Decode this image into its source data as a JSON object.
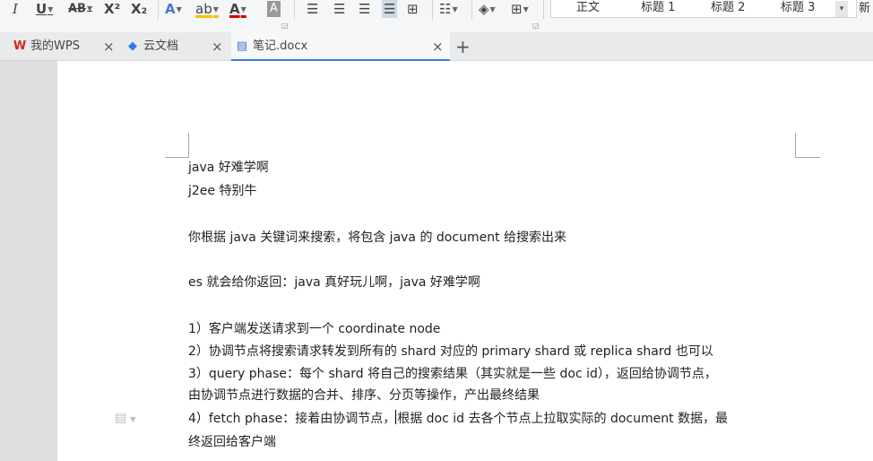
{
  "ribbon": {
    "italic": "I",
    "underline": "U",
    "strike": "AB",
    "superscript": "X²",
    "subscript": "X₂",
    "font_effect": "A",
    "highlight": "ab",
    "font_color": "A",
    "char_shading": "A",
    "styles": [
      "正文",
      "标题 1",
      "标题 2",
      "标题 3"
    ],
    "more": "新"
  },
  "tabs": [
    {
      "label": "我的WPS",
      "icon": "W"
    },
    {
      "label": "云文档",
      "icon": "◆"
    },
    {
      "label": "笔记.docx",
      "icon": "▤"
    }
  ],
  "document": {
    "lines": [
      "java 好难学啊",
      "j2ee 特别牛",
      "你根据 java 关键词来搜索，将包含 java 的 document 给搜索出来",
      "es 就会给你返回：java 真好玩儿啊，java 好难学啊",
      "1）客户端发送请求到一个 coordinate node",
      "2）协调节点将搜索请求转发到所有的 shard 对应的 primary shard 或 replica shard 也可以",
      "3）query phase：每个 shard 将自己的搜索结果（其实就是一些 doc id），返回给协调节点，",
      "由协调节点进行数据的合并、排序、分页等操作，产出最终结果",
      "4）fetch phase：接着由协调节点，",
      "根据 doc id 去各个节点上拉取实际的 document 数据，最",
      "终返回给客户端"
    ]
  }
}
